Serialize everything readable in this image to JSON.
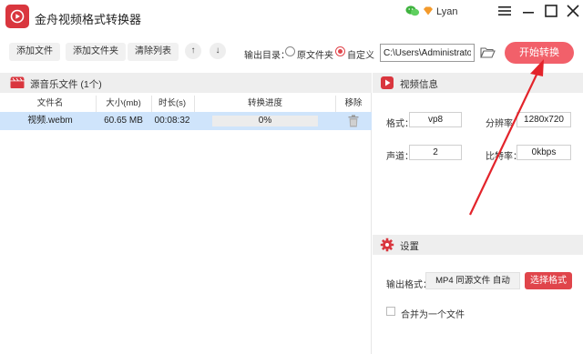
{
  "app": {
    "title": "金舟视频格式转换器",
    "username": "Lyan",
    "accent": "#e0454b"
  },
  "toolbar": {
    "add_file": "添加文件",
    "add_folder": "添加文件夹",
    "clear_list": "清除列表",
    "move_up": "↑",
    "move_down": "↓",
    "output_label": "输出目录：",
    "option_source": "原文件夹",
    "option_custom": "自定义",
    "selected_option": "自定义",
    "path_value": "C:\\Users\\Administrator",
    "start_button": "开始转换"
  },
  "file_panel": {
    "title": "源音乐文件 (1个)",
    "columns": [
      "文件名",
      "大小(mb)",
      "时长(s)",
      "转换进度",
      "移除"
    ],
    "rows": [
      {
        "name": "视频.webm",
        "size": "60.65 MB",
        "duration": "00:08:32",
        "progress": "0%",
        "progress_fraction": 0
      }
    ]
  },
  "video_info": {
    "title": "视频信息",
    "format_label": "格式：",
    "format_value": "vp8",
    "resolution_label": "分辨率",
    "resolution_value": "1280x720",
    "channels_label": "声道：",
    "channels_value": "2",
    "bitrate_label": "比特率：",
    "bitrate_value": "0kbps"
  },
  "settings": {
    "title": "设置",
    "output_format_label": "输出格式：",
    "output_format_value": "MP4 同源文件 自动",
    "choose_format_button": "选择格式",
    "merge_label": "合并为一个文件",
    "merge_checked": false
  }
}
